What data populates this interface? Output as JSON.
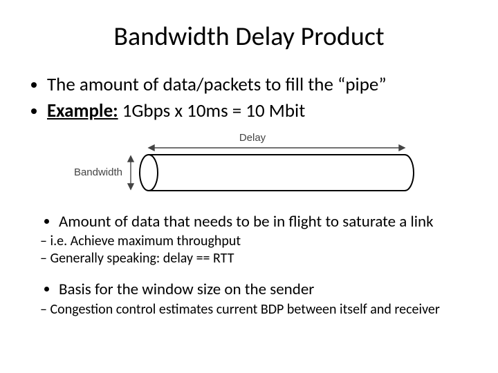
{
  "title": "Bandwidth Delay Product",
  "bullets": {
    "b1": "The amount of data/packets to fill the “pipe”",
    "b2_label": "Example:",
    "b2_rest": " 1Gbps x 10ms = 10 Mbit"
  },
  "figure": {
    "delay_label": "Delay",
    "bandwidth_label": "Bandwidth"
  },
  "bullets2": {
    "c1": "Amount of data that needs to be in flight to saturate a link",
    "c1_sub1": "i.e. Achieve maximum throughput",
    "c1_sub2": "Generally speaking: delay == RTT",
    "c2": "Basis for the window size on the sender",
    "c2_sub1": "Congestion control estimates current BDP between itself and receiver"
  }
}
